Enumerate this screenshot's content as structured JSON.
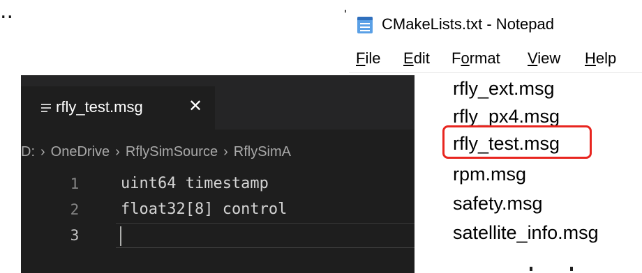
{
  "stray_text": "..",
  "editor": {
    "tab": {
      "icon": "list-icon",
      "filename": "rfly_test.msg",
      "close_glyph": "✕"
    },
    "breadcrumb": [
      "D:",
      "OneDrive",
      "RflySimSource",
      "RflySimA"
    ],
    "breadcrumb_separator": "›",
    "lines": [
      {
        "number": "1",
        "text": "uint64 timestamp"
      },
      {
        "number": "2",
        "text": "float32[8] control"
      },
      {
        "number": "3",
        "text": ""
      }
    ]
  },
  "notepad": {
    "title": "CMakeLists.txt - Notepad",
    "icon": "notepad-icon",
    "menus": [
      {
        "accel": "F",
        "rest": "ile",
        "pre": ""
      },
      {
        "accel": "E",
        "rest": "dit",
        "pre": ""
      },
      {
        "accel": "o",
        "rest": "rmat",
        "pre": "F"
      },
      {
        "accel": "V",
        "rest": "iew",
        "pre": ""
      },
      {
        "accel": "H",
        "rest": "elp",
        "pre": ""
      }
    ],
    "lines": [
      "rfly_ext.msg",
      "rfly_px4.msg",
      "rfly_test.msg",
      "rpm.msg",
      "safety.msg",
      "satellite_info.msg"
    ],
    "highlighted_line": "rfly_test.msg",
    "highlight_color": "#e8251f"
  },
  "colors": {
    "editor_background": "#1e1e1e",
    "tab_strip": "#252526",
    "line_number": "#858585",
    "code_text": "#d4d4d4",
    "breadcrumb_text": "#a9a9a9"
  }
}
